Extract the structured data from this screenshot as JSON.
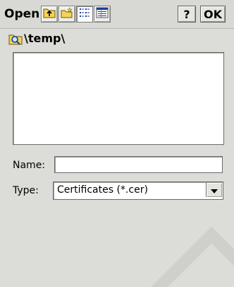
{
  "toolbar": {
    "title": "Open",
    "help_label": "?",
    "ok_label": "OK",
    "icons": [
      "up-folder-icon",
      "new-folder-icon",
      "list-view-icon",
      "details-view-icon"
    ]
  },
  "location": {
    "path": "\\temp\\",
    "icon": "folder-search-icon"
  },
  "form": {
    "name_label": "Name:",
    "name_value": "",
    "type_label": "Type:",
    "type_value": "Certificates (*.cer)"
  },
  "colors": {
    "background": "#dcdcd8",
    "field_bg": "#ffffff"
  }
}
